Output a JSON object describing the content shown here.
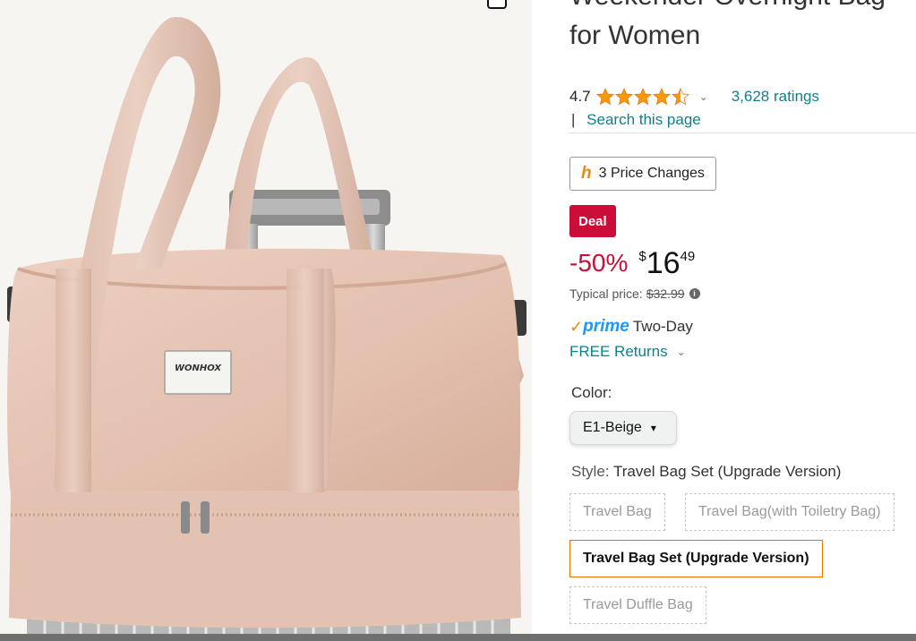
{
  "product": {
    "title_lines": [
      "Weekender Overnight Bag",
      "for Women"
    ],
    "rating_value": "4.7",
    "stars": 4.5,
    "ratings_count": "3,628 ratings",
    "search_link": "Search this page",
    "search_pipe": "|"
  },
  "price_history": {
    "label": "3 Price Changes",
    "logo": "h"
  },
  "deal": {
    "badge": "Deal",
    "discount": "-50%",
    "currency": "$",
    "price_whole": "16",
    "price_fraction": "49",
    "typical_label": "Typical price:",
    "typical_value": "$32.99"
  },
  "prime": {
    "check": "✓",
    "brand": "prime",
    "delivery": "Two-Day"
  },
  "returns": {
    "label": "FREE Returns"
  },
  "color": {
    "label": "Color:",
    "selected": "E1-Beige"
  },
  "style": {
    "label": "Style:",
    "selected_value": "Travel Bag Set (Upgrade Version)",
    "options": [
      {
        "label": "Travel Bag",
        "state": "unavailable"
      },
      {
        "label": "Travel Bag(with Toiletry Bag)",
        "state": "unavailable"
      },
      {
        "label": "Travel Bag Set (Upgrade Version)",
        "state": "selected"
      },
      {
        "label": "Travel Duffle Bag",
        "state": "unavailable"
      }
    ]
  },
  "image": {
    "brand_label": "WONHOX"
  },
  "colors": {
    "deal_red": "#cc0c39",
    "link_teal": "#117f8b",
    "prime_blue": "#1a98ff",
    "star_orange": "#ff9900",
    "bag_beige": "#e6c3b2",
    "selected_border": "#e77600"
  }
}
